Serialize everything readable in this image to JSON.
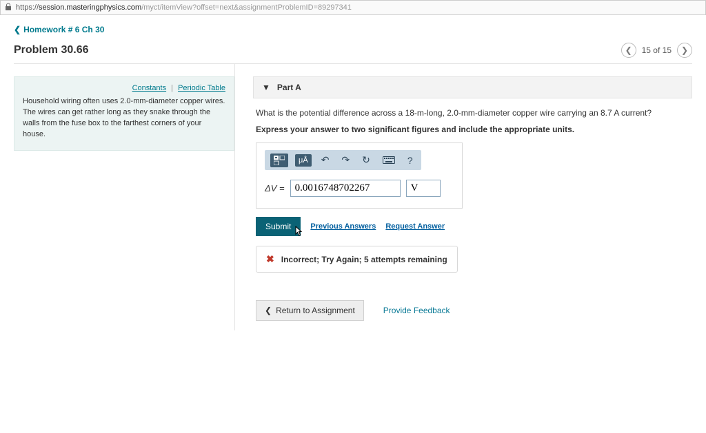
{
  "url": {
    "domain": "session.masteringphysics.com",
    "path": "/myct/itemView?offset=next&assignmentProblemID=89297341"
  },
  "breadcrumb": "Homework # 6 Ch 30",
  "problem_title": "Problem 30.66",
  "pager": {
    "text": "15 of 15"
  },
  "info": {
    "constants": "Constants",
    "periodic": "Periodic Table",
    "text": "Household wiring often uses 2.0-mm-diameter copper wires. The wires can get rather long as they snake through the walls from the fuse box to the farthest corners of your house."
  },
  "part": {
    "label": "Part A",
    "question": "What is the potential difference across a 18-m-long, 2.0-mm-diameter copper wire carrying an 8.7 A current?",
    "instruction": "Express your answer to two significant figures and include the appropriate units.",
    "units_button": "μÅ",
    "help": "?",
    "var_label": "ΔV =",
    "value": "0.0016748702267",
    "unit": "V",
    "submit": "Submit",
    "prev_answers": "Previous Answers",
    "request_answer": "Request Answer",
    "feedback": "Incorrect; Try Again; 5 attempts remaining"
  },
  "bottom": {
    "return": "Return to Assignment",
    "provide": "Provide Feedback"
  }
}
